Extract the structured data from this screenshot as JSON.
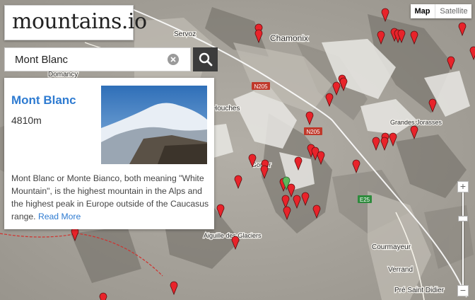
{
  "site": {
    "logo_text": "mountains.io"
  },
  "search": {
    "value": "Mont Blanc",
    "placeholder": ""
  },
  "card": {
    "title": "Mont Blanc",
    "elevation": "4810m",
    "description": "Mont Blanc or Monte Bianco, both meaning \"White Mountain\", is the highest mountain in the Alps and the highest peak in Europe outside of the Caucasus range.",
    "read_more": "Read More"
  },
  "map_type": {
    "map_label": "Map",
    "satellite_label": "Satellite",
    "selected": "Map"
  },
  "zoom": {
    "in_label": "+",
    "out_label": "−"
  },
  "place_labels": {
    "servoz": "Servoz",
    "chamonix": "Chamonix",
    "domancy": "Domancy",
    "houches": "Houches",
    "grandes_jorasses": "Grandes Jorasses",
    "aiguille_glaciers": "Aiguille des Glaciers",
    "courmayeur": "Courmayeur",
    "verrand": "Verrand",
    "pre_saint_didier": "Pré Saint Didier",
    "gouter": "Goûter",
    "e25": "E25",
    "n205_a": "N205",
    "n205_b": "N205"
  },
  "colors": {
    "accent": "#2e7bd1",
    "marker": "#e8232a",
    "selected_marker": "#5cb85c"
  }
}
